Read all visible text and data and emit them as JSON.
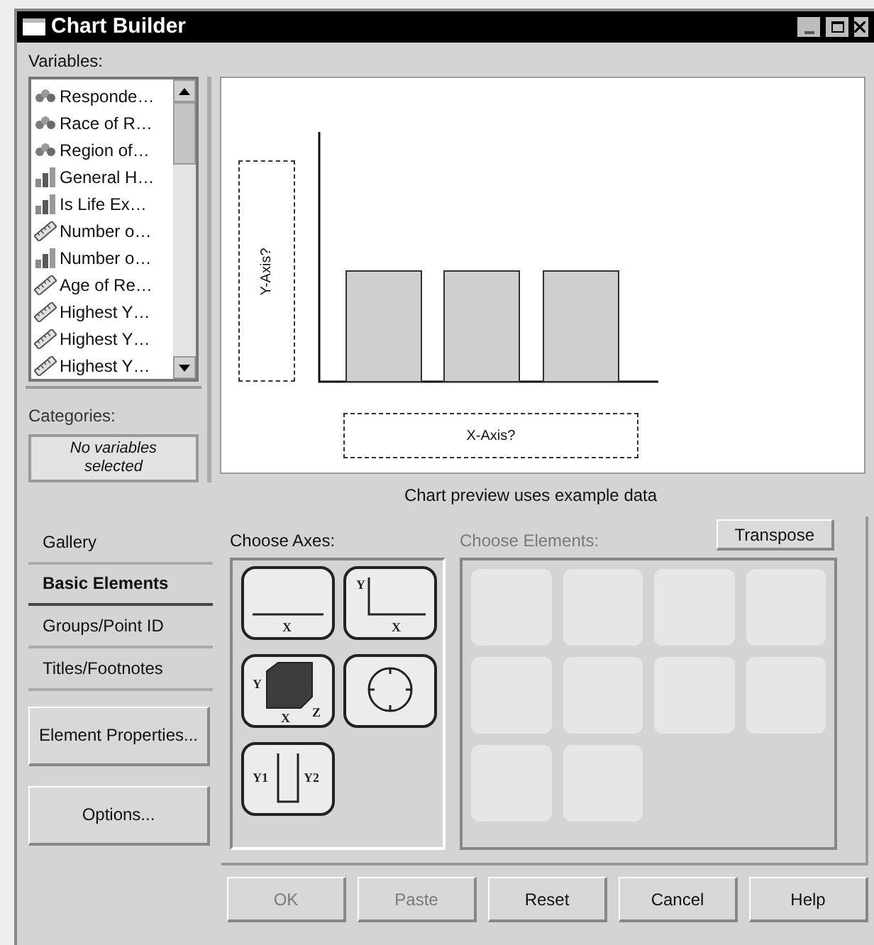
{
  "window": {
    "title": "Chart Builder"
  },
  "variables": {
    "label": "Variables:",
    "items": [
      {
        "name": "Responde…",
        "kind": "nominal"
      },
      {
        "name": "Race of R…",
        "kind": "nominal"
      },
      {
        "name": "Region of…",
        "kind": "nominal"
      },
      {
        "name": "General H…",
        "kind": "ordinal"
      },
      {
        "name": "Is Life Ex…",
        "kind": "ordinal"
      },
      {
        "name": "Number o…",
        "kind": "scale"
      },
      {
        "name": "Number o…",
        "kind": "ordinal"
      },
      {
        "name": "Age of Re…",
        "kind": "scale"
      },
      {
        "name": "Highest Y…",
        "kind": "scale"
      },
      {
        "name": "Highest Y…",
        "kind": "scale"
      },
      {
        "name": "Highest Y…",
        "kind": "scale"
      }
    ]
  },
  "categories": {
    "label": "Categories:",
    "empty_text": "No variables selected"
  },
  "preview": {
    "y_axis": "Y-Axis?",
    "x_axis": "X-Axis?",
    "caption": "Chart preview uses example data"
  },
  "tabs": [
    {
      "label": "Gallery",
      "selected": false
    },
    {
      "label": "Basic Elements",
      "selected": true
    },
    {
      "label": "Groups/Point ID",
      "selected": false
    },
    {
      "label": "Titles/Footnotes",
      "selected": false
    }
  ],
  "side_buttons": [
    "Element Properties...",
    "Options..."
  ],
  "choose_axes": {
    "label": "Choose Axes:",
    "items": [
      {
        "kind": "single",
        "labels": [
          "X"
        ]
      },
      {
        "kind": "cartesian",
        "labels": [
          "Y",
          "X"
        ]
      },
      {
        "kind": "cube",
        "labels": [
          "Y",
          "X",
          "Z"
        ]
      },
      {
        "kind": "polar"
      },
      {
        "kind": "dual",
        "labels": [
          "Y1",
          "Y2"
        ]
      }
    ]
  },
  "choose_elements": {
    "label": "Choose Elements:",
    "disabled": true
  },
  "transpose_button": "Transpose",
  "buttons": [
    {
      "label": "OK",
      "disabled": true
    },
    {
      "label": "Paste",
      "disabled": true
    },
    {
      "label": "Reset",
      "disabled": false
    },
    {
      "label": "Cancel",
      "disabled": false
    },
    {
      "label": "Help",
      "disabled": false
    }
  ]
}
